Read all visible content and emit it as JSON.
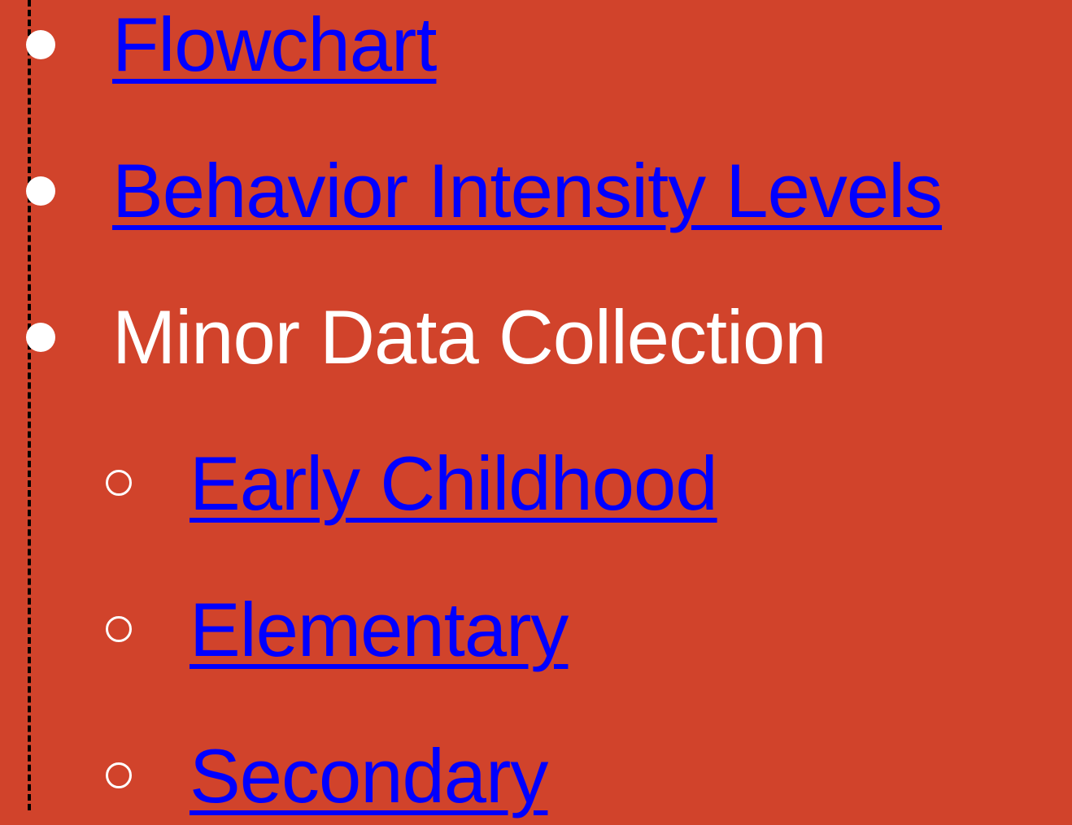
{
  "outline": {
    "items": [
      {
        "label": "Flowchart",
        "type": "link"
      },
      {
        "label": "Behavior Intensity Levels",
        "type": "link"
      },
      {
        "label": "Minor Data Collection",
        "type": "text",
        "children": [
          {
            "label": "Early Childhood",
            "type": "link"
          },
          {
            "label": "Elementary",
            "type": "link"
          },
          {
            "label": "Secondary",
            "type": "link"
          }
        ]
      }
    ]
  },
  "colors": {
    "background": "#d1432b",
    "link": "#0000ff",
    "text": "#ffffff",
    "guide": "#000000"
  },
  "icons": {
    "primary_bullet": "filled-circle",
    "secondary_bullet": "hollow-circle"
  }
}
